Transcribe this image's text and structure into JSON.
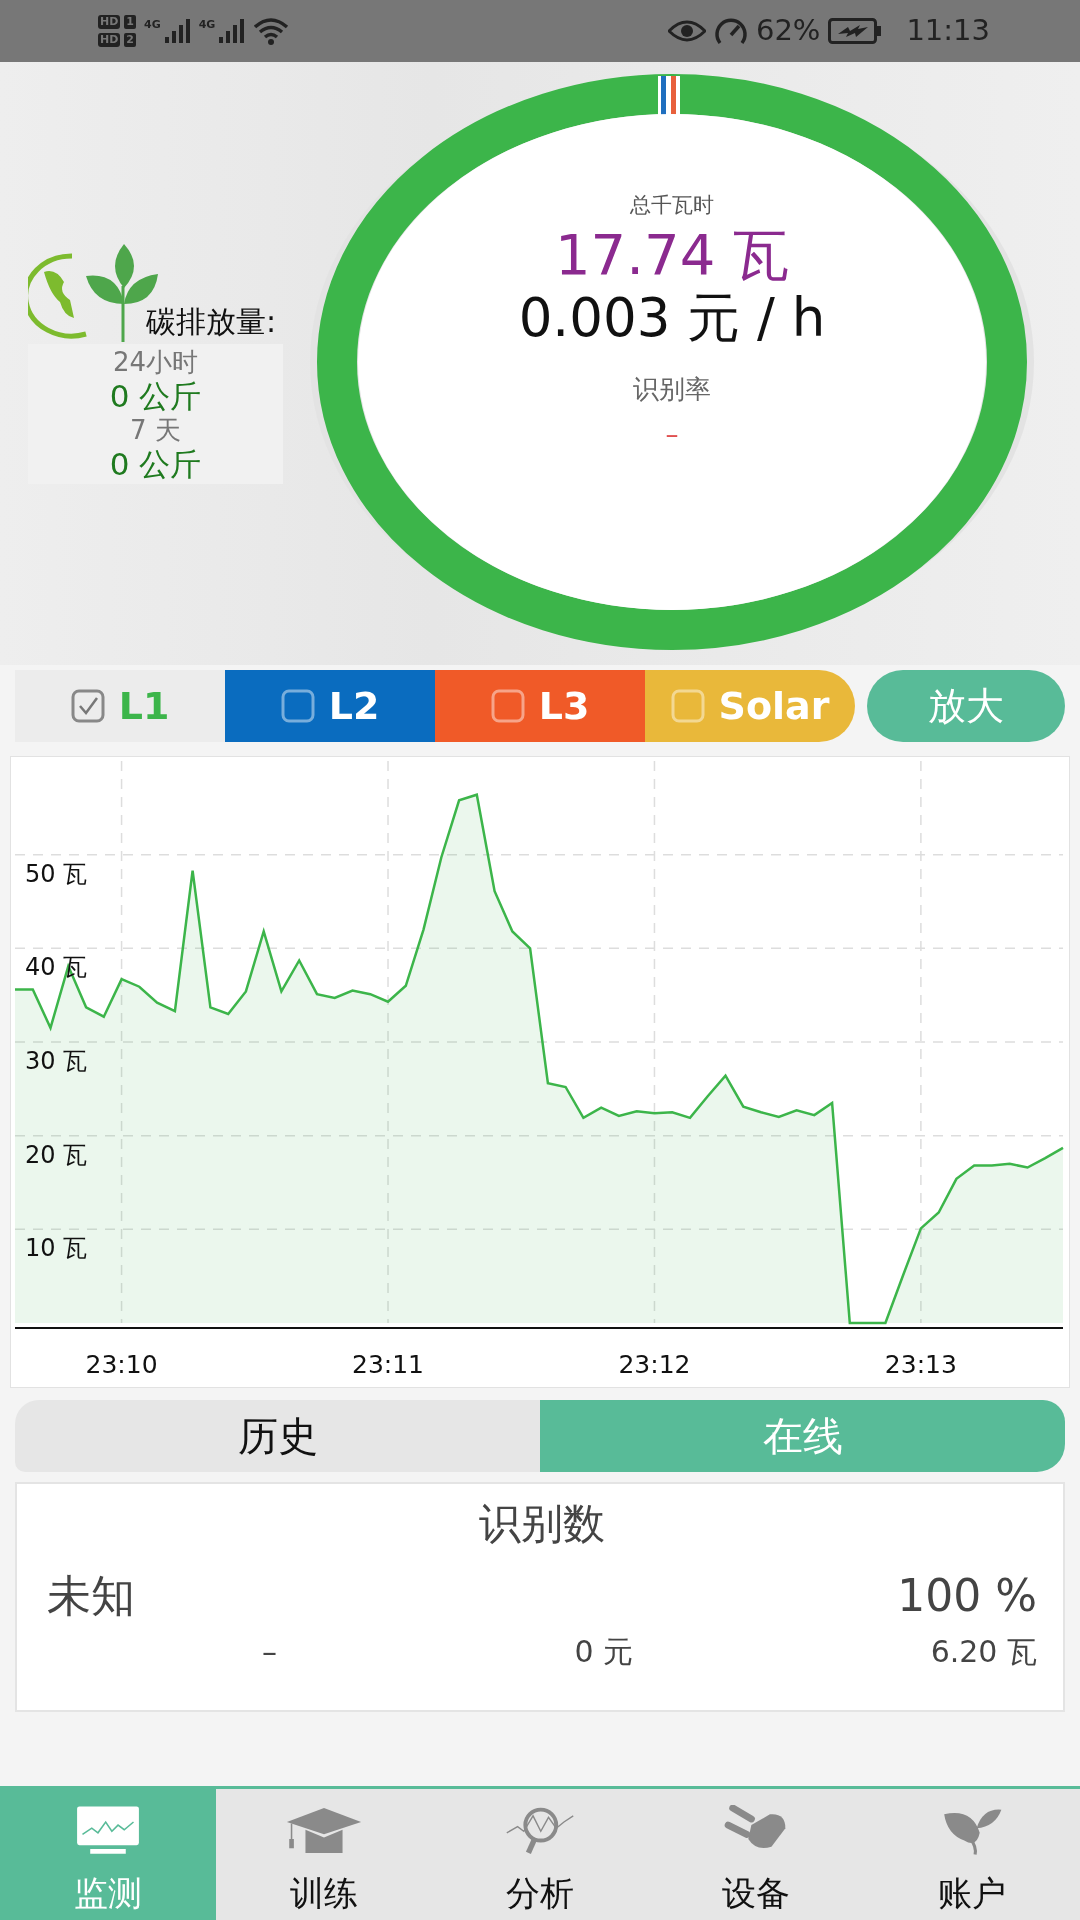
{
  "status_bar": {
    "sims": [
      {
        "hd": "HD",
        "slot": "1",
        "network": "4G"
      },
      {
        "hd": "HD",
        "slot": "2",
        "network": "4G"
      }
    ],
    "battery": "62%",
    "time": "11:13"
  },
  "carbon": {
    "title": "碳排放量:",
    "periods": [
      {
        "label": "24小时",
        "value": "0 公斤"
      },
      {
        "label": "7 天",
        "value": "0 公斤"
      }
    ]
  },
  "gauge": {
    "caption": "总千瓦时",
    "power": "17.74 瓦",
    "cost": "0.003 元 / h",
    "rate_label": "识别率",
    "rate_value": "–"
  },
  "legend": [
    {
      "label": "L1",
      "color": "#3cb54a",
      "checked": true
    },
    {
      "label": "L2",
      "color": "#0a6cbf",
      "checked": false
    },
    {
      "label": "L3",
      "color": "#f05a28",
      "checked": false
    },
    {
      "label": "Solar",
      "color": "#e9b83a",
      "checked": false
    }
  ],
  "zoom_button": "放大",
  "chart_data": {
    "type": "area",
    "grid": true,
    "ylim": [
      0,
      60
    ],
    "yticks": [
      {
        "value": 10,
        "label": "10 瓦"
      },
      {
        "value": 20,
        "label": "20 瓦"
      },
      {
        "value": 30,
        "label": "30 瓦"
      },
      {
        "value": 40,
        "label": "40 瓦"
      },
      {
        "value": 50,
        "label": "50 瓦"
      }
    ],
    "categories": [
      null,
      null,
      null,
      null,
      null,
      null,
      "23:10",
      null,
      null,
      null,
      null,
      null,
      null,
      null,
      null,
      null,
      null,
      null,
      null,
      null,
      null,
      "23:11",
      null,
      null,
      null,
      null,
      null,
      null,
      null,
      null,
      null,
      null,
      null,
      null,
      null,
      null,
      "23:12",
      null,
      null,
      null,
      null,
      null,
      null,
      null,
      null,
      null,
      null,
      null,
      null,
      null,
      null,
      "23:13",
      null,
      null,
      null,
      null,
      null,
      null,
      null,
      null
    ],
    "series": [
      {
        "color": "#3cb54a",
        "values": [
          35.6,
          35.6,
          31.5,
          38.1,
          33.7,
          32.7,
          36.7,
          35.9,
          34.2,
          33.3,
          48.3,
          33.7,
          33.0,
          35.4,
          41.8,
          35.4,
          38.7,
          35.1,
          34.7,
          35.5,
          35.1,
          34.3,
          36.0,
          42.0,
          49.7,
          55.8,
          56.4,
          46.1,
          41.8,
          40.0,
          25.6,
          25.2,
          21.9,
          23.0,
          22.1,
          22.6,
          22.4,
          22.5,
          21.9,
          24.2,
          26.4,
          23.1,
          22.5,
          22.0,
          22.7,
          22.2,
          23.5,
          0,
          0,
          0,
          5.1,
          10.1,
          11.8,
          15.4,
          16.8,
          16.8,
          17.0,
          16.6,
          17.6,
          18.7
        ]
      }
    ]
  },
  "mode_tabs": [
    {
      "label": "历史",
      "selected": false
    },
    {
      "label": "在线",
      "selected": true
    }
  ],
  "recognition": {
    "title": "识别数",
    "items": [
      {
        "name": "未知",
        "share": "100 %",
        "column_1": "–",
        "cost": "0 元",
        "power": "6.20 瓦"
      }
    ]
  },
  "nav": [
    {
      "label": "监测",
      "selected": true
    },
    {
      "label": "训练",
      "selected": false
    },
    {
      "label": "分析",
      "selected": false
    },
    {
      "label": "设备",
      "selected": false
    },
    {
      "label": "账户",
      "selected": false
    }
  ]
}
